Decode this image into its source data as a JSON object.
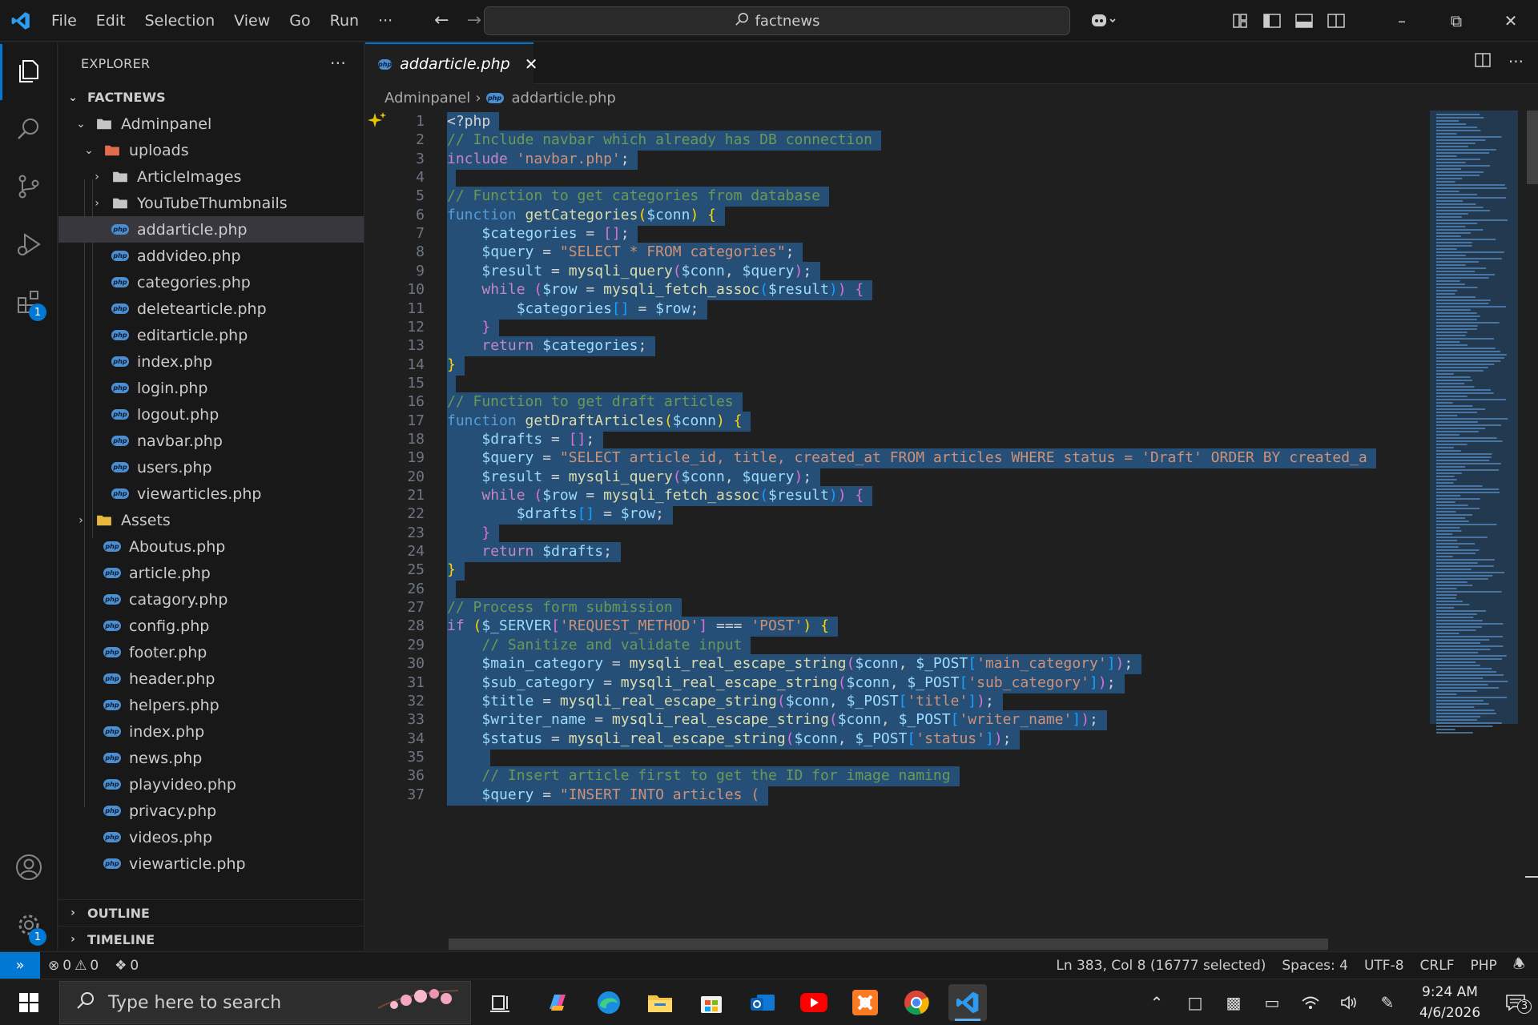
{
  "titlebar": {
    "menu": [
      "File",
      "Edit",
      "Selection",
      "View",
      "Go",
      "Run",
      "···"
    ],
    "search": "factnews"
  },
  "activity": {
    "extensions_badge": "1",
    "settings_badge": "1"
  },
  "explorer": {
    "title": "EXPLORER",
    "root": "FACTNEWS",
    "tree": [
      {
        "label": "Adminpanel",
        "depth": 1,
        "kind": "folder-open"
      },
      {
        "label": "uploads",
        "depth": 2,
        "kind": "folder-open-red"
      },
      {
        "label": "ArticleImages",
        "depth": 3,
        "kind": "folder"
      },
      {
        "label": "YouTubeThumbnails",
        "depth": 3,
        "kind": "folder"
      },
      {
        "label": "addarticle.php",
        "depth": 3,
        "kind": "php",
        "selected": true
      },
      {
        "label": "addvideo.php",
        "depth": 3,
        "kind": "php"
      },
      {
        "label": "categories.php",
        "depth": 3,
        "kind": "php"
      },
      {
        "label": "deletearticle.php",
        "depth": 3,
        "kind": "php"
      },
      {
        "label": "editarticle.php",
        "depth": 3,
        "kind": "php"
      },
      {
        "label": "index.php",
        "depth": 3,
        "kind": "php"
      },
      {
        "label": "login.php",
        "depth": 3,
        "kind": "php"
      },
      {
        "label": "logout.php",
        "depth": 3,
        "kind": "php"
      },
      {
        "label": "navbar.php",
        "depth": 3,
        "kind": "php"
      },
      {
        "label": "users.php",
        "depth": 3,
        "kind": "php"
      },
      {
        "label": "viewarticles.php",
        "depth": 3,
        "kind": "php"
      },
      {
        "label": "Assets",
        "depth": 1,
        "kind": "folder-yellow"
      },
      {
        "label": "Aboutus.php",
        "depth": 2,
        "kind": "php"
      },
      {
        "label": "article.php",
        "depth": 2,
        "kind": "php"
      },
      {
        "label": "catagory.php",
        "depth": 2,
        "kind": "php"
      },
      {
        "label": "config.php",
        "depth": 2,
        "kind": "php"
      },
      {
        "label": "footer.php",
        "depth": 2,
        "kind": "php"
      },
      {
        "label": "header.php",
        "depth": 2,
        "kind": "php"
      },
      {
        "label": "helpers.php",
        "depth": 2,
        "kind": "php"
      },
      {
        "label": "index.php",
        "depth": 2,
        "kind": "php"
      },
      {
        "label": "news.php",
        "depth": 2,
        "kind": "php"
      },
      {
        "label": "playvideo.php",
        "depth": 2,
        "kind": "php"
      },
      {
        "label": "privacy.php",
        "depth": 2,
        "kind": "php"
      },
      {
        "label": "videos.php",
        "depth": 2,
        "kind": "php"
      },
      {
        "label": "viewarticle.php",
        "depth": 2,
        "kind": "php"
      }
    ],
    "outline": "OUTLINE",
    "timeline": "TIMELINE"
  },
  "tab": {
    "label": "addarticle.php"
  },
  "breadcrumb": {
    "folder": "Adminpanel",
    "file": "addarticle.php"
  },
  "code": [
    [
      [
        "pl",
        "<?php"
      ]
    ],
    [
      [
        "cm",
        "// Include navbar which already has DB connection"
      ]
    ],
    [
      [
        "kw",
        "include"
      ],
      [
        "pl",
        " "
      ],
      [
        "str",
        "'navbar.php'"
      ],
      [
        "pl",
        ";"
      ]
    ],
    [],
    [
      [
        "cm",
        "// Function to get categories from database"
      ]
    ],
    [
      [
        "blue",
        "function"
      ],
      [
        "pl",
        " "
      ],
      [
        "fn",
        "getCategories"
      ],
      [
        "br",
        "("
      ],
      [
        "var",
        "$conn"
      ],
      [
        "br",
        ")"
      ],
      [
        "pl",
        " "
      ],
      [
        "br",
        "{"
      ]
    ],
    [
      [
        "pl",
        "    "
      ],
      [
        "var",
        "$categories"
      ],
      [
        "pl",
        " = "
      ],
      [
        "br2",
        "[]"
      ],
      [
        "pl",
        ";"
      ]
    ],
    [
      [
        "pl",
        "    "
      ],
      [
        "var",
        "$query"
      ],
      [
        "pl",
        " = "
      ],
      [
        "str",
        "\"SELECT * FROM categories\""
      ],
      [
        "pl",
        ";"
      ]
    ],
    [
      [
        "pl",
        "    "
      ],
      [
        "var",
        "$result"
      ],
      [
        "pl",
        " = "
      ],
      [
        "fn",
        "mysqli_query"
      ],
      [
        "br2",
        "("
      ],
      [
        "var",
        "$conn"
      ],
      [
        "pl",
        ", "
      ],
      [
        "var",
        "$query"
      ],
      [
        "br2",
        ")"
      ],
      [
        "pl",
        ";"
      ]
    ],
    [
      [
        "pl",
        "    "
      ],
      [
        "kw",
        "while"
      ],
      [
        "pl",
        " "
      ],
      [
        "br2",
        "("
      ],
      [
        "var",
        "$row"
      ],
      [
        "pl",
        " = "
      ],
      [
        "fn",
        "mysqli_fetch_assoc"
      ],
      [
        "br3",
        "("
      ],
      [
        "var",
        "$result"
      ],
      [
        "br3",
        ")"
      ],
      [
        "br2",
        ")"
      ],
      [
        "pl",
        " "
      ],
      [
        "br2",
        "{"
      ]
    ],
    [
      [
        "pl",
        "        "
      ],
      [
        "var",
        "$categories"
      ],
      [
        "br3",
        "[]"
      ],
      [
        "pl",
        " = "
      ],
      [
        "var",
        "$row"
      ],
      [
        "pl",
        ";"
      ]
    ],
    [
      [
        "pl",
        "    "
      ],
      [
        "br2",
        "}"
      ]
    ],
    [
      [
        "pl",
        "    "
      ],
      [
        "kw",
        "return"
      ],
      [
        "pl",
        " "
      ],
      [
        "var",
        "$categories"
      ],
      [
        "pl",
        ";"
      ]
    ],
    [
      [
        "br",
        "}"
      ]
    ],
    [],
    [
      [
        "cm",
        "// Function to get draft articles"
      ]
    ],
    [
      [
        "blue",
        "function"
      ],
      [
        "pl",
        " "
      ],
      [
        "fn",
        "getDraftArticles"
      ],
      [
        "br",
        "("
      ],
      [
        "var",
        "$conn"
      ],
      [
        "br",
        ")"
      ],
      [
        "pl",
        " "
      ],
      [
        "br",
        "{"
      ]
    ],
    [
      [
        "pl",
        "    "
      ],
      [
        "var",
        "$drafts"
      ],
      [
        "pl",
        " = "
      ],
      [
        "br2",
        "[]"
      ],
      [
        "pl",
        ";"
      ]
    ],
    [
      [
        "pl",
        "    "
      ],
      [
        "var",
        "$query"
      ],
      [
        "pl",
        " = "
      ],
      [
        "str",
        "\"SELECT article_id, title, created_at FROM articles WHERE status = 'Draft' ORDER BY created_a"
      ]
    ],
    [
      [
        "pl",
        "    "
      ],
      [
        "var",
        "$result"
      ],
      [
        "pl",
        " = "
      ],
      [
        "fn",
        "mysqli_query"
      ],
      [
        "br2",
        "("
      ],
      [
        "var",
        "$conn"
      ],
      [
        "pl",
        ", "
      ],
      [
        "var",
        "$query"
      ],
      [
        "br2",
        ")"
      ],
      [
        "pl",
        ";"
      ]
    ],
    [
      [
        "pl",
        "    "
      ],
      [
        "kw",
        "while"
      ],
      [
        "pl",
        " "
      ],
      [
        "br2",
        "("
      ],
      [
        "var",
        "$row"
      ],
      [
        "pl",
        " = "
      ],
      [
        "fn",
        "mysqli_fetch_assoc"
      ],
      [
        "br3",
        "("
      ],
      [
        "var",
        "$result"
      ],
      [
        "br3",
        ")"
      ],
      [
        "br2",
        ")"
      ],
      [
        "pl",
        " "
      ],
      [
        "br2",
        "{"
      ]
    ],
    [
      [
        "pl",
        "        "
      ],
      [
        "var",
        "$drafts"
      ],
      [
        "br3",
        "[]"
      ],
      [
        "pl",
        " = "
      ],
      [
        "var",
        "$row"
      ],
      [
        "pl",
        ";"
      ]
    ],
    [
      [
        "pl",
        "    "
      ],
      [
        "br2",
        "}"
      ]
    ],
    [
      [
        "pl",
        "    "
      ],
      [
        "kw",
        "return"
      ],
      [
        "pl",
        " "
      ],
      [
        "var",
        "$drafts"
      ],
      [
        "pl",
        ";"
      ]
    ],
    [
      [
        "br",
        "}"
      ]
    ],
    [],
    [
      [
        "cm",
        "// Process form submission"
      ]
    ],
    [
      [
        "kw",
        "if"
      ],
      [
        "pl",
        " "
      ],
      [
        "br",
        "("
      ],
      [
        "var",
        "$_SERVER"
      ],
      [
        "br2",
        "["
      ],
      [
        "str",
        "'REQUEST_METHOD'"
      ],
      [
        "br2",
        "]"
      ],
      [
        "pl",
        " === "
      ],
      [
        "str",
        "'POST'"
      ],
      [
        "br",
        ")"
      ],
      [
        "pl",
        " "
      ],
      [
        "br",
        "{"
      ]
    ],
    [
      [
        "pl",
        "    "
      ],
      [
        "cm",
        "// Sanitize and validate input"
      ]
    ],
    [
      [
        "pl",
        "    "
      ],
      [
        "var",
        "$main_category"
      ],
      [
        "pl",
        " = "
      ],
      [
        "fn",
        "mysqli_real_escape_string"
      ],
      [
        "br2",
        "("
      ],
      [
        "var",
        "$conn"
      ],
      [
        "pl",
        ", "
      ],
      [
        "var",
        "$_POST"
      ],
      [
        "br3",
        "["
      ],
      [
        "str",
        "'main_category'"
      ],
      [
        "br3",
        "]"
      ],
      [
        "br2",
        ")"
      ],
      [
        "pl",
        ";"
      ]
    ],
    [
      [
        "pl",
        "    "
      ],
      [
        "var",
        "$sub_category"
      ],
      [
        "pl",
        " = "
      ],
      [
        "fn",
        "mysqli_real_escape_string"
      ],
      [
        "br2",
        "("
      ],
      [
        "var",
        "$conn"
      ],
      [
        "pl",
        ", "
      ],
      [
        "var",
        "$_POST"
      ],
      [
        "br3",
        "["
      ],
      [
        "str",
        "'sub_category'"
      ],
      [
        "br3",
        "]"
      ],
      [
        "br2",
        ")"
      ],
      [
        "pl",
        ";"
      ]
    ],
    [
      [
        "pl",
        "    "
      ],
      [
        "var",
        "$title"
      ],
      [
        "pl",
        " = "
      ],
      [
        "fn",
        "mysqli_real_escape_string"
      ],
      [
        "br2",
        "("
      ],
      [
        "var",
        "$conn"
      ],
      [
        "pl",
        ", "
      ],
      [
        "var",
        "$_POST"
      ],
      [
        "br3",
        "["
      ],
      [
        "str",
        "'title'"
      ],
      [
        "br3",
        "]"
      ],
      [
        "br2",
        ")"
      ],
      [
        "pl",
        ";"
      ]
    ],
    [
      [
        "pl",
        "    "
      ],
      [
        "var",
        "$writer_name"
      ],
      [
        "pl",
        " = "
      ],
      [
        "fn",
        "mysqli_real_escape_string"
      ],
      [
        "br2",
        "("
      ],
      [
        "var",
        "$conn"
      ],
      [
        "pl",
        ", "
      ],
      [
        "var",
        "$_POST"
      ],
      [
        "br3",
        "["
      ],
      [
        "str",
        "'writer_name'"
      ],
      [
        "br3",
        "]"
      ],
      [
        "br2",
        ")"
      ],
      [
        "pl",
        ";"
      ]
    ],
    [
      [
        "pl",
        "    "
      ],
      [
        "var",
        "$status"
      ],
      [
        "pl",
        " = "
      ],
      [
        "fn",
        "mysqli_real_escape_string"
      ],
      [
        "br2",
        "("
      ],
      [
        "var",
        "$conn"
      ],
      [
        "pl",
        ", "
      ],
      [
        "var",
        "$_POST"
      ],
      [
        "br3",
        "["
      ],
      [
        "str",
        "'status'"
      ],
      [
        "br3",
        "]"
      ],
      [
        "br2",
        ")"
      ],
      [
        "pl",
        ";"
      ]
    ],
    [
      [
        "pl",
        "    "
      ]
    ],
    [
      [
        "pl",
        "    "
      ],
      [
        "cm",
        "// Insert article first to get the ID for image naming"
      ]
    ],
    [
      [
        "pl",
        "    "
      ],
      [
        "var",
        "$query"
      ],
      [
        "pl",
        " = "
      ],
      [
        "str",
        "\"INSERT INTO articles ("
      ]
    ]
  ],
  "statusbar": {
    "errors": "0",
    "warnings": "0",
    "ports": "0",
    "position": "Ln 383, Col 8 (16777 selected)",
    "spaces": "Spaces: 4",
    "encoding": "UTF-8",
    "eol": "CRLF",
    "language": "PHP"
  },
  "taskbar": {
    "search_placeholder": "Type here to search",
    "time": "9:24 AM",
    "date": "4/6/2026",
    "notifications": "3"
  },
  "colors": {
    "accent": "#0078d4",
    "selection": "#264f78"
  }
}
